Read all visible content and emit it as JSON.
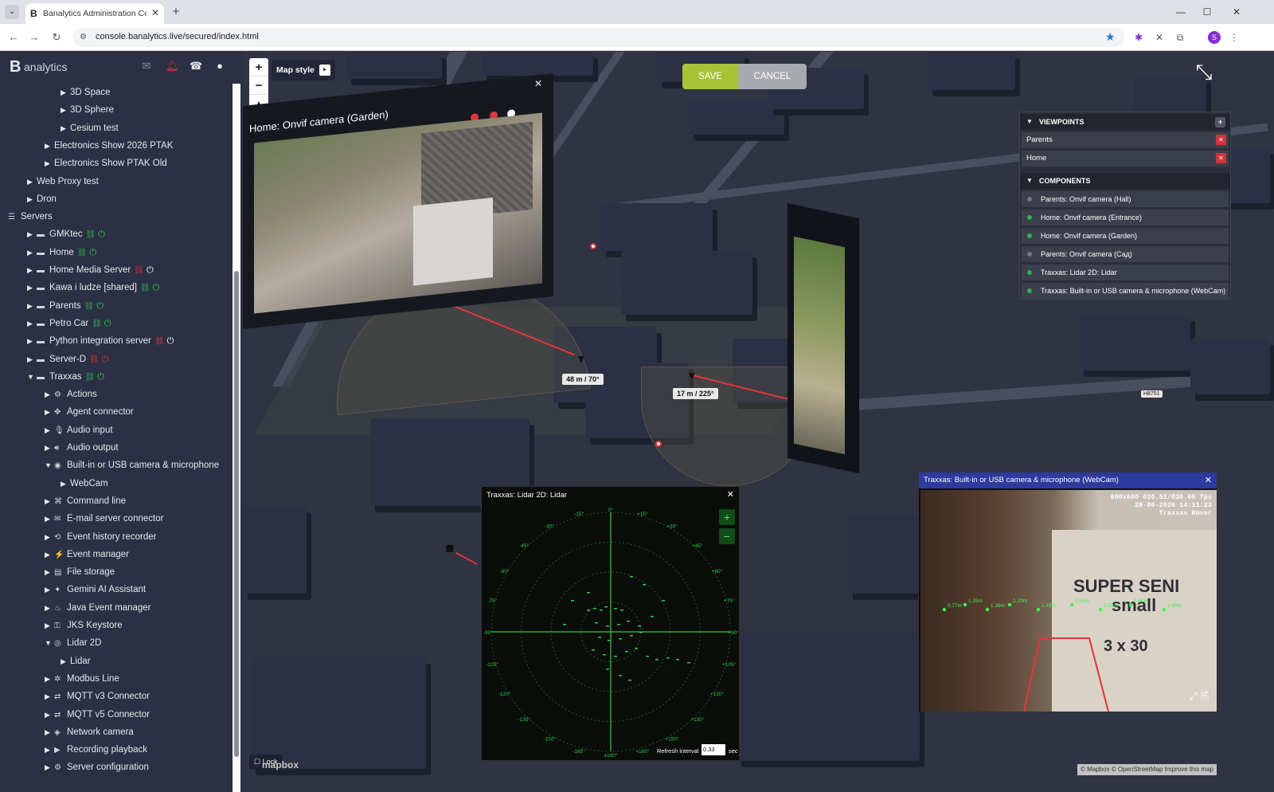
{
  "browser": {
    "tab_title": "Banalytics Administration Cons",
    "url": "console.banalytics.live/secured/index.html",
    "profile_initial": "S"
  },
  "sidebar": {
    "logo_letter": "B",
    "logo_text": "analytics",
    "tree": [
      {
        "label": "3D Space",
        "level": 3,
        "arrow": "right",
        "icon": ""
      },
      {
        "label": "3D Sphere",
        "level": 3,
        "arrow": "right",
        "icon": ""
      },
      {
        "label": "Cesium test",
        "level": 3,
        "arrow": "right",
        "icon": ""
      },
      {
        "label": "Electronics Show 2026 PTAK",
        "level": 2,
        "arrow": "right",
        "icon": ""
      },
      {
        "label": "Electronics Show PTAK Old",
        "level": 2,
        "arrow": "right",
        "icon": ""
      },
      {
        "label": "Web Proxy test",
        "level": 1,
        "arrow": "right",
        "icon": ""
      },
      {
        "label": "Dron",
        "level": 1,
        "arrow": "right",
        "icon": ""
      },
      {
        "label": "Servers",
        "level": 0,
        "arrow": "",
        "icon": "servers-icon"
      },
      {
        "label": "GMKtec",
        "level": 1,
        "arrow": "right",
        "icon": "server-icon",
        "link": "green",
        "power": "green"
      },
      {
        "label": "Home",
        "level": 1,
        "arrow": "right",
        "icon": "server-icon",
        "link": "green",
        "power": "green"
      },
      {
        "label": "Home Media Server",
        "level": 1,
        "arrow": "right",
        "icon": "server-icon",
        "link": "red",
        "power": "white"
      },
      {
        "label": "Kawa i ludze [shared]",
        "level": 1,
        "arrow": "right",
        "icon": "server-icon",
        "link": "green",
        "power": "green"
      },
      {
        "label": "Parents",
        "level": 1,
        "arrow": "right",
        "icon": "server-icon",
        "link": "green",
        "power": "green"
      },
      {
        "label": "Petro Car",
        "level": 1,
        "arrow": "right",
        "icon": "server-icon",
        "link": "green",
        "power": "green"
      },
      {
        "label": "Python integration server",
        "level": 1,
        "arrow": "right",
        "icon": "server-icon",
        "link": "red",
        "power": "white"
      },
      {
        "label": "Server-D",
        "level": 1,
        "arrow": "right",
        "icon": "server-icon",
        "link": "red",
        "power": "red"
      },
      {
        "label": "Traxxas",
        "level": 1,
        "arrow": "down",
        "icon": "server-icon",
        "link": "green",
        "power": "green"
      },
      {
        "label": "Actions",
        "level": 2,
        "arrow": "right",
        "icon": "actions-icon"
      },
      {
        "label": "Agent connector",
        "level": 2,
        "arrow": "right",
        "icon": "agent-icon"
      },
      {
        "label": "Audio input",
        "level": 2,
        "arrow": "right",
        "icon": "microphone-icon"
      },
      {
        "label": "Audio output",
        "level": 2,
        "arrow": "right",
        "icon": "speaker-icon"
      },
      {
        "label": "Built-in or USB camera & microphone",
        "level": 2,
        "arrow": "down",
        "icon": "webcam-icon"
      },
      {
        "label": "WebCam",
        "level": 3,
        "arrow": "right",
        "icon": ""
      },
      {
        "label": "Command line",
        "level": 2,
        "arrow": "right",
        "icon": "command-icon"
      },
      {
        "label": "E-mail server connector",
        "level": 2,
        "arrow": "right",
        "icon": "email-icon"
      },
      {
        "label": "Event history recorder",
        "level": 2,
        "arrow": "right",
        "icon": "history-icon"
      },
      {
        "label": "Event manager",
        "level": 2,
        "arrow": "right",
        "icon": "event-icon"
      },
      {
        "label": "File storage",
        "level": 2,
        "arrow": "right",
        "icon": "storage-icon"
      },
      {
        "label": "Gemini AI Assistant",
        "level": 2,
        "arrow": "right",
        "icon": "ai-icon"
      },
      {
        "label": "Java Event manager",
        "level": 2,
        "arrow": "right",
        "icon": "java-icon"
      },
      {
        "label": "JKS Keystore",
        "level": 2,
        "arrow": "right",
        "icon": "keystore-icon"
      },
      {
        "label": "Lidar 2D",
        "level": 2,
        "arrow": "down",
        "icon": "lidar-icon"
      },
      {
        "label": "Lidar",
        "level": 3,
        "arrow": "right",
        "icon": ""
      },
      {
        "label": "Modbus Line",
        "level": 2,
        "arrow": "right",
        "icon": "modbus-icon"
      },
      {
        "label": "MQTT v3 Connector",
        "level": 2,
        "arrow": "right",
        "icon": "mqtt-icon"
      },
      {
        "label": "MQTT v5 Connector",
        "level": 2,
        "arrow": "right",
        "icon": "mqtt-icon"
      },
      {
        "label": "Network camera",
        "level": 2,
        "arrow": "right",
        "icon": "camera-icon"
      },
      {
        "label": "Recording playback",
        "level": 2,
        "arrow": "right",
        "icon": "playback-icon"
      },
      {
        "label": "Server configuration",
        "level": 2,
        "arrow": "right",
        "icon": "config-icon"
      }
    ]
  },
  "map": {
    "map_style_label": "Map style",
    "save_label": "SAVE",
    "cancel_label": "CANCEL",
    "lock_label": "Lock",
    "mapbox_logo": "mapbox",
    "attribution": "© Mapbox © OpenStreetMap Improve this map",
    "road_label": "H8751",
    "measure_1": "48 m / 70°",
    "measure_2": "17 m / 225°"
  },
  "viewpoints": {
    "header": "VIEWPOINTS",
    "items": [
      "Parents",
      "Home"
    ]
  },
  "components": {
    "header": "COMPONENTS",
    "items": [
      {
        "label": "Parents: Onvif camera (Hall)",
        "active": false
      },
      {
        "label": "Home: Onvif camera (Entrance)",
        "active": true
      },
      {
        "label": "Home: Onvif camera (Garden)",
        "active": true
      },
      {
        "label": "Parents: Onvif camera (Сад)",
        "active": false
      },
      {
        "label": "Traxxas: Lidar 2D: Lidar",
        "active": true
      },
      {
        "label": "Traxxas: Built-in or USB camera & microphone (WebCam)",
        "active": true
      }
    ]
  },
  "garden_panel": {
    "title": "Home: Onvif camera (Garden)"
  },
  "lidar_panel": {
    "title": "Traxxas: Lidar 2D: Lidar",
    "refresh_label": "Refresh interval",
    "refresh_value": "0.33",
    "refresh_unit": "sec",
    "angles": [
      "0°",
      "+15°",
      "+30°",
      "+45°",
      "+60°",
      "+75°",
      "+90°",
      "+105°",
      "+120°",
      "+135°",
      "+150°",
      "+165°",
      "±180°",
      "-165°",
      "-150°",
      "-135°",
      "-120°",
      "-105°",
      "-90°",
      "-75°",
      "-60°",
      "-45°",
      "-30°",
      "-15°"
    ]
  },
  "webcam_panel": {
    "title": "Traxxas: Built-in or USB camera & microphone (WebCam)",
    "osd_line1": "800x600 020.51/030.00 fps",
    "osd_line2": "28-06-2026 14:11:22",
    "osd_line3": "Traxxas Rover",
    "box_text1": "SUPER SENI",
    "box_text2": "small",
    "box_text3": "3 x 30",
    "distances": [
      "0.77m",
      "1.25m",
      "1.39m",
      "1.70m",
      "1.49m",
      "1.50m",
      "1.50m",
      "1.60m",
      "1.60m"
    ]
  }
}
